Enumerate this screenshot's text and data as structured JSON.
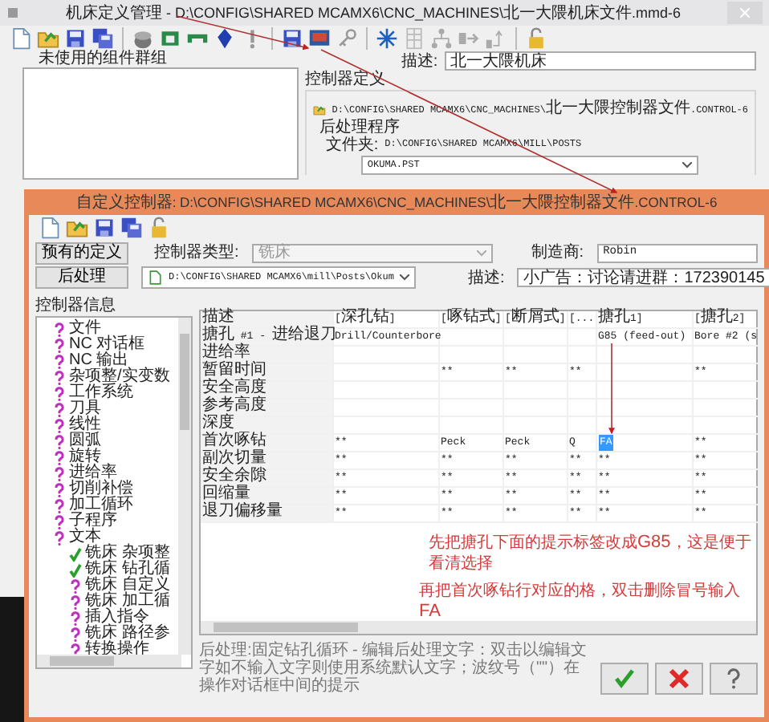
{
  "main_window": {
    "title": "机床定义管理 - D:\\CONFIG\\SHARED MCAMX6\\CNC_MACHINES\\北一大隈机床文件.mmd-6",
    "unused_groups_label": "未使用的组件群组",
    "description_label": "描述:",
    "description": "北一大隈机床",
    "control_definition_label": "控制器定义",
    "control_file": "D:\\CONFIG\\SHARED MCAMX6\\CNC_MACHINES\\北一大隈控制器文件.CONTROL-6",
    "post_label": "后处理程序",
    "folder_label": "文件夹:",
    "folder": "D:\\CONFIG\\SHARED MCAMX6\\MILL\\POSTS",
    "post_file": "OKUMA.PST"
  },
  "dialog": {
    "title": "自定义控制器: D:\\CONFIG\\SHARED MCAMX6\\CNC_MACHINES\\北一大隈控制器文件.CONTROL-6",
    "existing_button": "预有的定义",
    "post_button": "后处理",
    "control_type_label": "控制器类型:",
    "control_type": {
      "value": "铣床",
      "disabled": true
    },
    "post_path": "D:\\CONFIG\\SHARED MCAMX6\\mill\\Posts\\Okum",
    "maker_label": "制造商:",
    "maker": "Robin",
    "description_label": "描述:",
    "description": "小广告：讨论请进群：172390145",
    "tree_label": "控制器信息",
    "tree": [
      {
        "label": "文件",
        "kind": "question"
      },
      {
        "label": "NC 对话框",
        "kind": "question"
      },
      {
        "label": "NC 输出",
        "kind": "question"
      },
      {
        "label": "杂项整/实变数",
        "kind": "question"
      },
      {
        "label": "工作系统",
        "kind": "question"
      },
      {
        "label": "刀具",
        "kind": "question"
      },
      {
        "label": "线性",
        "kind": "question"
      },
      {
        "label": "圆弧",
        "kind": "question"
      },
      {
        "label": "旋转",
        "kind": "question"
      },
      {
        "label": "进给率",
        "kind": "question"
      },
      {
        "label": "切削补偿",
        "kind": "question"
      },
      {
        "label": "加工循环",
        "kind": "question"
      },
      {
        "label": "子程序",
        "kind": "question"
      },
      {
        "label": "文本",
        "kind": "question",
        "expanded": true,
        "children": [
          {
            "label": "铣床 杂项整",
            "kind": "check"
          },
          {
            "label": "铣床 钻孔循",
            "kind": "check"
          },
          {
            "label": "铣床 自定义",
            "kind": "question"
          },
          {
            "label": "铣床 加工循",
            "kind": "question"
          },
          {
            "label": "插入指令",
            "kind": "question"
          },
          {
            "label": "铣床 路径参",
            "kind": "question"
          },
          {
            "label": "转换操作",
            "kind": "question"
          }
        ]
      }
    ],
    "table": {
      "label_header": "描述",
      "columns": [
        "[深孔钻]",
        "[啄钻式]",
        "[断屑式]",
        "[...",
        "搪孔1]",
        "[搪孔2]"
      ],
      "rows": [
        {
          "label": "搪孔 #1 - 进给退刀",
          "cells": [
            {
              "text": "Drill/Counterbore",
              "selected": false
            },
            {
              "selected": false
            },
            {
              "selected": false
            },
            {
              "selected": false
            },
            {
              "text": "G85 (feed-out)",
              "selected": false
            },
            {
              "text": "Bore #2 (s",
              "selected": false
            }
          ]
        },
        {
          "label": "进给率",
          "cells": [
            {
              "selected": false
            },
            {
              "selected": false
            },
            {
              "selected": false
            },
            {
              "selected": false
            },
            {
              "selected": false
            },
            {
              "selected": false
            }
          ]
        },
        {
          "label": "暂留时间",
          "cells": [
            {
              "selected": false
            },
            {
              "text": "**",
              "selected": false
            },
            {
              "text": "**",
              "selected": false
            },
            {
              "text": "**",
              "selected": false
            },
            {
              "selected": false
            },
            {
              "text": "**",
              "selected": false
            }
          ]
        },
        {
          "label": "安全高度",
          "cells": [
            {
              "selected": false
            },
            {
              "selected": false
            },
            {
              "selected": false
            },
            {
              "selected": false
            },
            {
              "selected": false
            },
            {
              "selected": false
            }
          ]
        },
        {
          "label": "参考高度",
          "cells": [
            {
              "selected": false
            },
            {
              "selected": false
            },
            {
              "selected": false
            },
            {
              "selected": false
            },
            {
              "selected": false
            },
            {
              "selected": false
            }
          ]
        },
        {
          "label": "深度",
          "cells": [
            {
              "selected": false
            },
            {
              "selected": false
            },
            {
              "selected": false
            },
            {
              "selected": false
            },
            {
              "selected": false
            },
            {
              "selected": false
            }
          ]
        },
        {
          "label": "首次啄钻",
          "cells": [
            {
              "text": "**",
              "selected": false
            },
            {
              "text": "Peck",
              "selected": false
            },
            {
              "text": "Peck",
              "selected": false
            },
            {
              "text": "Q",
              "selected": false
            },
            {
              "text": "FA",
              "selected": true
            },
            {
              "text": "**",
              "selected": false
            }
          ]
        },
        {
          "label": "副次切量",
          "cells": [
            {
              "text": "**",
              "selected": false
            },
            {
              "text": "**",
              "selected": false
            },
            {
              "text": "**",
              "selected": false
            },
            {
              "text": "**",
              "selected": false
            },
            {
              "text": "**",
              "selected": false
            },
            {
              "text": "**",
              "selected": false
            }
          ]
        },
        {
          "label": "安全余隙",
          "cells": [
            {
              "text": "**",
              "selected": false
            },
            {
              "text": "**",
              "selected": false
            },
            {
              "text": "**",
              "selected": false
            },
            {
              "text": "**",
              "selected": false
            },
            {
              "text": "**",
              "selected": false
            },
            {
              "text": "**",
              "selected": false
            }
          ]
        },
        {
          "label": "回缩量",
          "cells": [
            {
              "text": "**",
              "selected": false
            },
            {
              "text": "**",
              "selected": false
            },
            {
              "text": "**",
              "selected": false
            },
            {
              "text": "**",
              "selected": false
            },
            {
              "text": "**",
              "selected": false
            },
            {
              "text": "**",
              "selected": false
            }
          ]
        },
        {
          "label": "退刀偏移量",
          "cells": [
            {
              "text": "**",
              "selected": false
            },
            {
              "text": "**",
              "selected": false
            },
            {
              "text": "**",
              "selected": false
            },
            {
              "text": "**",
              "selected": false
            },
            {
              "text": "**",
              "selected": false
            },
            {
              "text": "**",
              "selected": false
            }
          ]
        }
      ]
    },
    "annotations": [
      "先把搪孔下面的提示标签改成G85，这是便于看清选择",
      "再把首次啄钻行对应的格，双击删除冒号输入 FA"
    ],
    "help_text": "后处理:固定钻孔循环 - 编辑后处理文字：双击以编辑文字如不输入文字则使用系统默认文字；波纹号（\"\"）在操作对话框中间的提示",
    "buttons": [
      {
        "kind": "ok"
      },
      {
        "kind": "cancel"
      },
      {
        "kind": "help"
      }
    ]
  }
}
